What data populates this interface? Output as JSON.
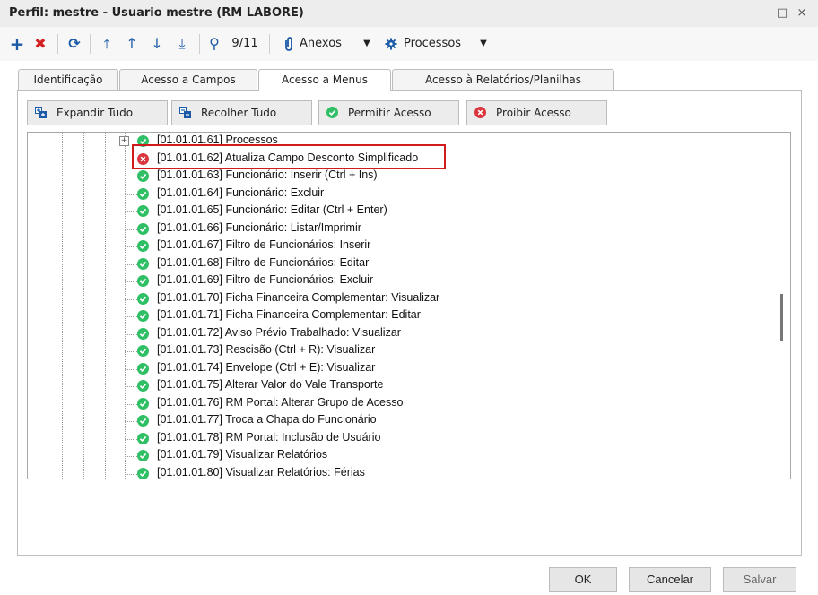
{
  "window": {
    "title": "Perfil: mestre - Usuario mestre (RM LABORE)",
    "restore_glyph": "□",
    "close_glyph": "×"
  },
  "toolbar": {
    "add_glyph": "+",
    "delete_glyph": "✖",
    "refresh_glyph": "⟳",
    "first_glyph": "⤒",
    "prev_glyph": "↑",
    "next_glyph": "↓",
    "last_glyph": "⤓",
    "search_glyph": "⚲",
    "record_position": "9/11",
    "attachments_label": "Anexos",
    "processes_label": "Processos",
    "dropdown_glyph": "▼"
  },
  "tabs": [
    {
      "label": "Identificação"
    },
    {
      "label": "Acesso a Campos"
    },
    {
      "label": "Acesso a Menus"
    },
    {
      "label": "Acesso à Relatórios/Planilhas"
    }
  ],
  "actions": {
    "expand_all": "Expandir Tudo",
    "collapse_all": "Recolher Tudo",
    "allow_access": "Permitir Acesso",
    "deny_access": "Proibir Acesso"
  },
  "tree": {
    "expander_glyph": "+",
    "items": [
      {
        "label": "[01.01.01.61] Processos",
        "status": "allowed",
        "expandable": true
      },
      {
        "label": "[01.01.01.62] Atualiza Campo Desconto Simplificado",
        "status": "denied",
        "highlighted": true
      },
      {
        "label": "[01.01.01.63] Funcionário: Inserir (Ctrl + Ins)",
        "status": "allowed"
      },
      {
        "label": "[01.01.01.64] Funcionário: Excluir",
        "status": "allowed"
      },
      {
        "label": "[01.01.01.65] Funcionário: Editar (Ctrl + Enter)",
        "status": "allowed"
      },
      {
        "label": "[01.01.01.66] Funcionário: Listar/Imprimir",
        "status": "allowed"
      },
      {
        "label": "[01.01.01.67] Filtro de Funcionários: Inserir",
        "status": "allowed"
      },
      {
        "label": "[01.01.01.68] Filtro de Funcionários: Editar",
        "status": "allowed"
      },
      {
        "label": "[01.01.01.69] Filtro de Funcionários: Excluir",
        "status": "allowed"
      },
      {
        "label": "[01.01.01.70] Ficha Financeira Complementar: Visualizar",
        "status": "allowed"
      },
      {
        "label": "[01.01.01.71] Ficha Financeira Complementar: Editar",
        "status": "allowed"
      },
      {
        "label": "[01.01.01.72] Aviso Prévio Trabalhado: Visualizar",
        "status": "allowed"
      },
      {
        "label": "[01.01.01.73] Rescisão (Ctrl + R): Visualizar",
        "status": "allowed"
      },
      {
        "label": "[01.01.01.74] Envelope (Ctrl + E): Visualizar",
        "status": "allowed"
      },
      {
        "label": "[01.01.01.75] Alterar Valor do Vale Transporte",
        "status": "allowed"
      },
      {
        "label": "[01.01.01.76] RM Portal: Alterar Grupo de Acesso",
        "status": "allowed"
      },
      {
        "label": "[01.01.01.77] Troca a Chapa do Funcionário",
        "status": "allowed"
      },
      {
        "label": "[01.01.01.78] RM Portal:  Inclusão de Usuário",
        "status": "allowed"
      },
      {
        "label": "[01.01.01.79] Visualizar Relatórios",
        "status": "allowed"
      },
      {
        "label": "[01.01.01.80] Visualizar Relatórios: Férias",
        "status": "allowed"
      }
    ]
  },
  "footer": {
    "ok_label": "OK",
    "cancel_label": "Cancelar",
    "save_label": "Salvar"
  },
  "colors": {
    "allowed": "#2fbf64",
    "denied": "#d9363e",
    "highlight": "#d11a1a",
    "toolbar_blue": "#1a5aa6"
  }
}
